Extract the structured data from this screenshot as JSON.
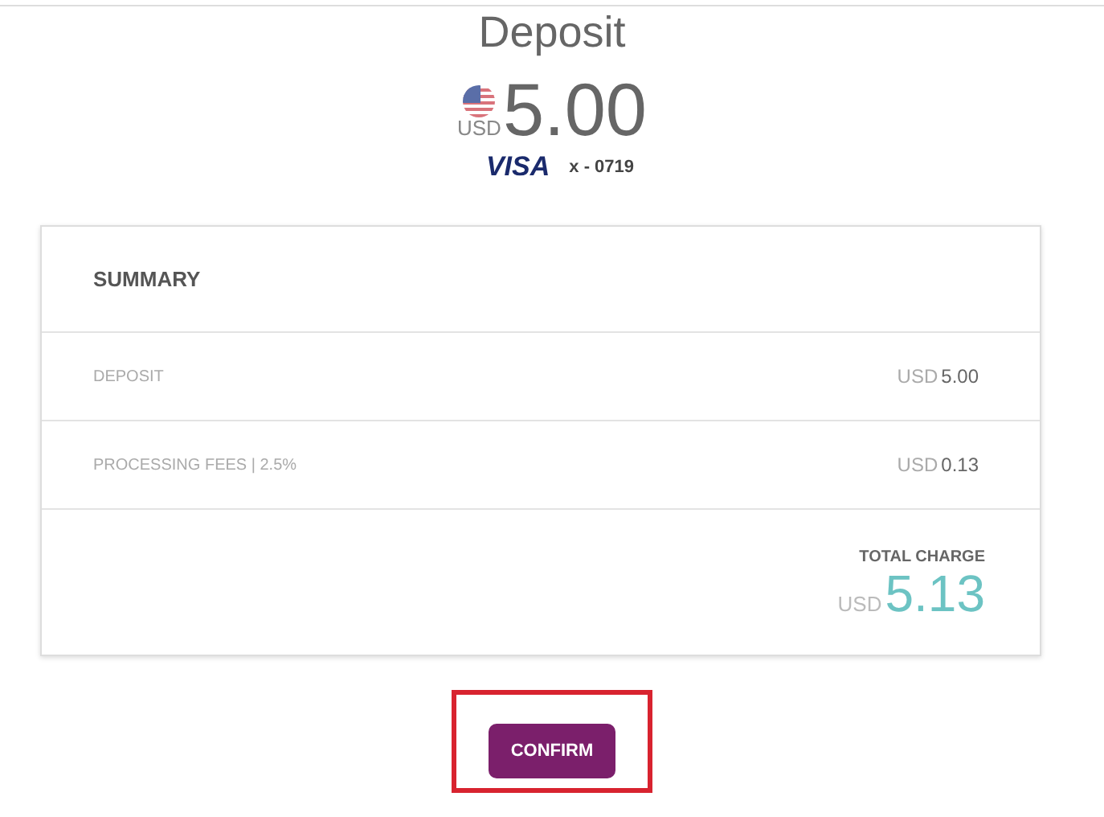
{
  "title": "Deposit",
  "amount": {
    "currency": "USD",
    "value": "5.00"
  },
  "card": {
    "brand": "VISA",
    "number": "x - 0719"
  },
  "summary": {
    "title": "SUMMARY",
    "rows": [
      {
        "label": "DEPOSIT",
        "currency": "USD",
        "value": "5.00"
      },
      {
        "label": "PROCESSING FEES | 2.5%",
        "currency": "USD",
        "value": "0.13"
      }
    ],
    "total": {
      "label": "TOTAL CHARGE",
      "currency": "USD",
      "value": "5.13"
    }
  },
  "confirm_button": {
    "label": "CONFIRM",
    "highlighted": true
  }
}
